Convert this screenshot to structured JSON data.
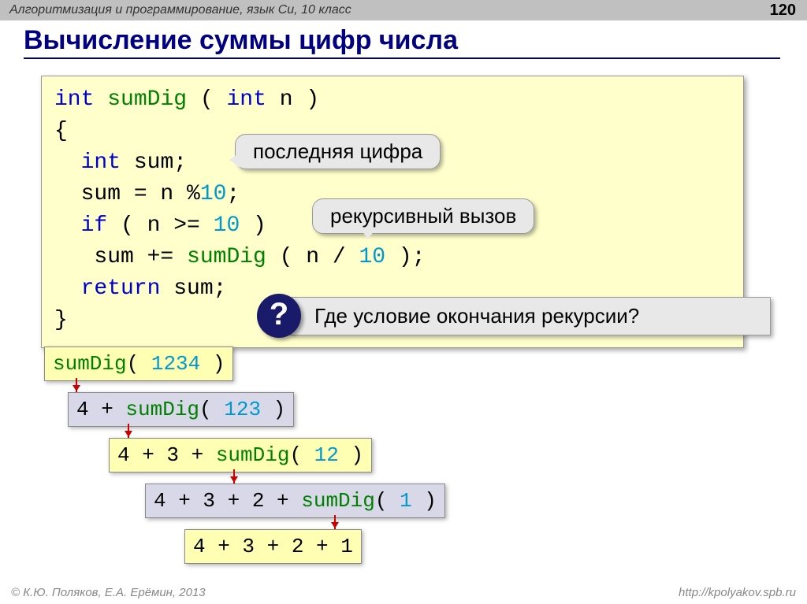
{
  "header": {
    "breadcrumb": "Алгоритмизация и программирование, язык Си, 10 класс",
    "page": "120"
  },
  "title": "Вычисление суммы цифр числа",
  "code": {
    "l1_kw1": "int",
    "l1_name": "sumDig",
    "l1_open": " ( ",
    "l1_kw2": "int",
    "l1_rest": " n )",
    "l2": "{",
    "l3_kw": "int",
    "l3_rest": " sum;",
    "l4_a": "sum = n %",
    "l4_num": "10",
    "l4_b": ";",
    "l5_kw": "if",
    "l5_a": " ( n >= ",
    "l5_num": "10",
    "l5_b": " )",
    "l6_a": " sum += ",
    "l6_name": "sumDig",
    "l6_b": " ( n / ",
    "l6_num": "10",
    "l6_c": " );",
    "l7_kw": "return",
    "l7_rest": " sum;",
    "l8": "}"
  },
  "callouts": {
    "last_digit": "последняя цифра",
    "recursive_call": "рекурсивный вызов",
    "question_mark": "?",
    "question_text": "Где условие окончания рекурсии?"
  },
  "chain": {
    "c1_name": "sumDig",
    "c1_a": "( ",
    "c1_num": "1234",
    "c1_b": " )",
    "c2_a": "4 + ",
    "c2_name": "sumDig",
    "c2_b": "( ",
    "c2_num": "123",
    "c2_c": " )",
    "c3_a": "4 + 3 + ",
    "c3_name": "sumDig",
    "c3_b": "( ",
    "c3_num": "12",
    "c3_c": " )",
    "c4_a": "4 + 3 + 2 + ",
    "c4_name": "sumDig",
    "c4_b": "( ",
    "c4_num": "1",
    "c4_c": " )",
    "c5": "4 + 3 + 2 + 1"
  },
  "footer": {
    "copyright": "© К.Ю. Поляков, Е.А. Ерёмин, 2013",
    "url": "http://kpolyakov.spb.ru"
  }
}
